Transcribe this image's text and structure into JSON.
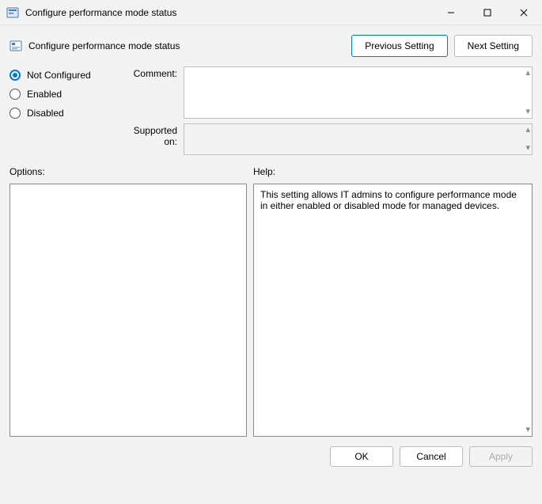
{
  "window": {
    "title": "Configure performance mode status"
  },
  "header": {
    "title": "Configure performance mode status",
    "prev_button": "Previous Setting",
    "next_button": "Next Setting"
  },
  "state": {
    "options": [
      {
        "label": "Not Configured",
        "selected": true
      },
      {
        "label": "Enabled",
        "selected": false
      },
      {
        "label": "Disabled",
        "selected": false
      }
    ],
    "comment_label": "Comment:",
    "comment_value": "",
    "supported_label": "Supported on:",
    "supported_value": ""
  },
  "labels": {
    "options": "Options:",
    "help": "Help:"
  },
  "help": {
    "text": "This setting allows IT admins to configure performance mode in either enabled or disabled mode for managed devices."
  },
  "buttons": {
    "ok": "OK",
    "cancel": "Cancel",
    "apply": "Apply"
  }
}
